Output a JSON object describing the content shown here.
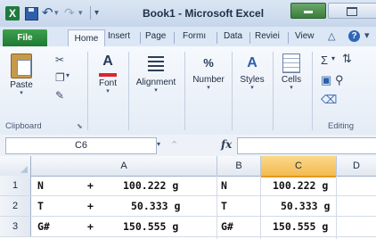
{
  "titlebar": {
    "app_icon": "X",
    "title": "Book1 - Microsoft Excel",
    "icons": [
      "excel-icon",
      "save-icon",
      "undo-icon",
      "redo-icon",
      "customize-qat-icon",
      "minimize-icon",
      "maximize-icon"
    ]
  },
  "tabs": [
    "File",
    "Home",
    "Insert",
    "Page",
    "Formı",
    "Data",
    "Reviei",
    "View"
  ],
  "ribbon": {
    "paste": "Paste",
    "font": "Font",
    "alignment": "Alignment",
    "number": "Number",
    "number_icon": "%",
    "styles": "Styles",
    "styles_icon": "A",
    "cells": "Cells",
    "font_icon": "A",
    "sum_icon": "Σ",
    "groups": {
      "clipboard": "Clipboard",
      "editing": "Editing"
    }
  },
  "formula_bar": {
    "name_box": "C6",
    "fx": "fx",
    "value": ""
  },
  "columns": [
    "A",
    "B",
    "C",
    "D"
  ],
  "selected_column": "C",
  "rows": [
    {
      "num": "1",
      "a_sym": "N",
      "a_op": "+",
      "a_val": "100.222 g",
      "b": "N",
      "c": "100.222 g"
    },
    {
      "num": "2",
      "a_sym": "T",
      "a_op": "+",
      "a_val": "50.333 g",
      "b": "T",
      "c": "50.333 g"
    },
    {
      "num": "3",
      "a_sym": "G#",
      "a_op": "+",
      "a_val": "150.555 g",
      "b": "G#",
      "c": "150.555 g"
    }
  ]
}
